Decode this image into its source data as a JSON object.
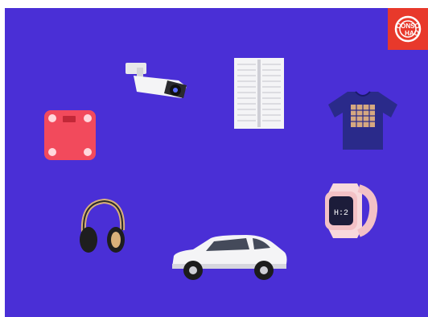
{
  "background_color": "#4a2fd6",
  "logo": {
    "text_line1": "CONSO",
    "text_line2": "HAO",
    "color": "#e8392b"
  },
  "items": [
    {
      "name": "security-camera-icon"
    },
    {
      "name": "window-blinds-icon"
    },
    {
      "name": "smart-scale-icon"
    },
    {
      "name": "smart-tshirt-icon"
    },
    {
      "name": "headphones-icon"
    },
    {
      "name": "smartwatch-icon",
      "watch_face_text": "H:2"
    },
    {
      "name": "suv-car-icon"
    }
  ]
}
